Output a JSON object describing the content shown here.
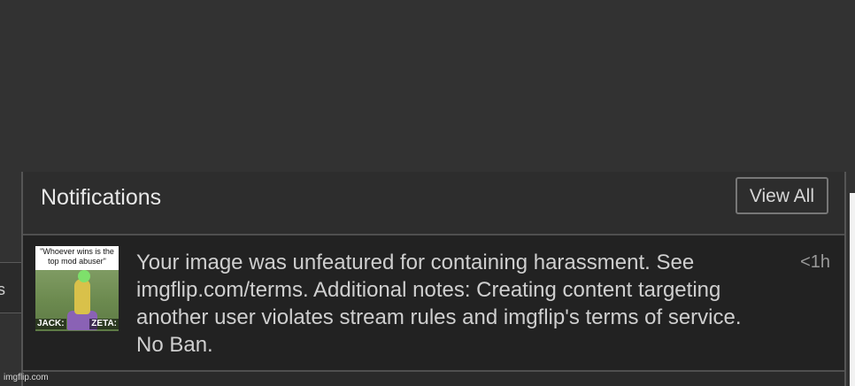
{
  "panel": {
    "title": "Notifications",
    "view_all_label": "View All"
  },
  "notification": {
    "thumbnail": {
      "caption": "\"Whoever wins is the top mod abuser\"",
      "left_label": "JACK:",
      "right_label": "ZETA:"
    },
    "message": "Your image was unfeatured for containing harassment. See imgflip.com/terms. Additional notes: Creating content targeting another user violates stream rules and imgflip's terms of service. No Ban.",
    "time": "<1h"
  },
  "left_tab_glyph": "s",
  "watermark": "imgflip.com",
  "colors": {
    "background": "#323232",
    "panel": "#2a2a2a",
    "notification_bg": "#222222",
    "text": "#cfcfcf",
    "muted": "#9a9a9a"
  }
}
